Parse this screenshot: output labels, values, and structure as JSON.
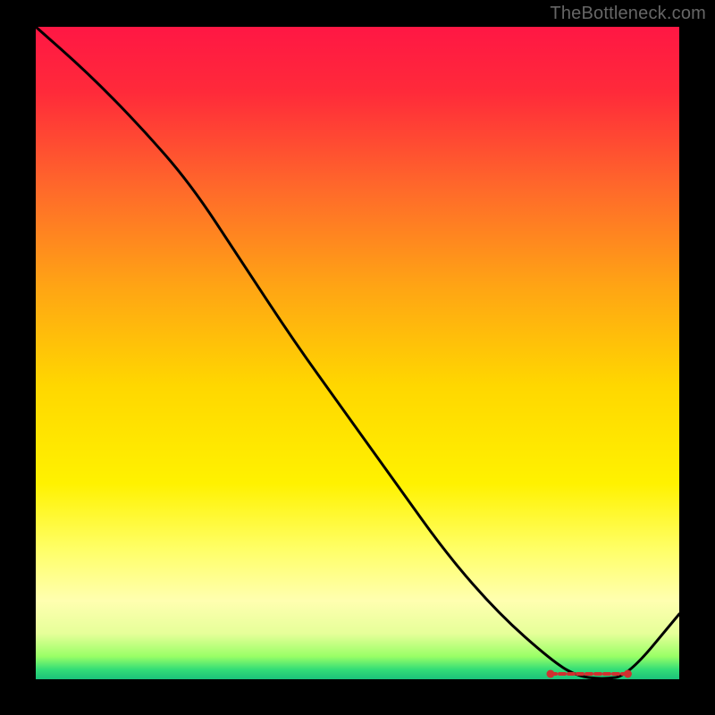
{
  "attribution": "TheBottleneck.com",
  "colors": {
    "frame": "#000000",
    "attribution_text": "#666666",
    "curve": "#000000",
    "marker": "#d03030"
  },
  "gradient_stops": [
    {
      "offset": 0.0,
      "color": "#ff1744"
    },
    {
      "offset": 0.1,
      "color": "#ff2a3a"
    },
    {
      "offset": 0.25,
      "color": "#ff6a2a"
    },
    {
      "offset": 0.4,
      "color": "#ffa514"
    },
    {
      "offset": 0.55,
      "color": "#ffd700"
    },
    {
      "offset": 0.7,
      "color": "#fff200"
    },
    {
      "offset": 0.8,
      "color": "#ffff66"
    },
    {
      "offset": 0.88,
      "color": "#ffffb0"
    },
    {
      "offset": 0.93,
      "color": "#e6ff99"
    },
    {
      "offset": 0.965,
      "color": "#99ff66"
    },
    {
      "offset": 0.985,
      "color": "#33dd77"
    },
    {
      "offset": 1.0,
      "color": "#1bc27a"
    }
  ],
  "chart_data": {
    "type": "line",
    "title": "",
    "xlabel": "",
    "ylabel": "",
    "xlim": [
      0,
      1
    ],
    "ylim": [
      0,
      1
    ],
    "series": [
      {
        "name": "curve",
        "x": [
          0.0,
          0.08,
          0.16,
          0.24,
          0.32,
          0.4,
          0.48,
          0.56,
          0.64,
          0.72,
          0.8,
          0.84,
          0.88,
          0.92,
          1.0
        ],
        "y": [
          1.0,
          0.93,
          0.85,
          0.76,
          0.64,
          0.52,
          0.41,
          0.3,
          0.19,
          0.1,
          0.03,
          0.005,
          0.0,
          0.005,
          0.1
        ]
      }
    ],
    "min_marker": {
      "x_start": 0.8,
      "x_end": 0.92,
      "y": 0.0
    }
  }
}
